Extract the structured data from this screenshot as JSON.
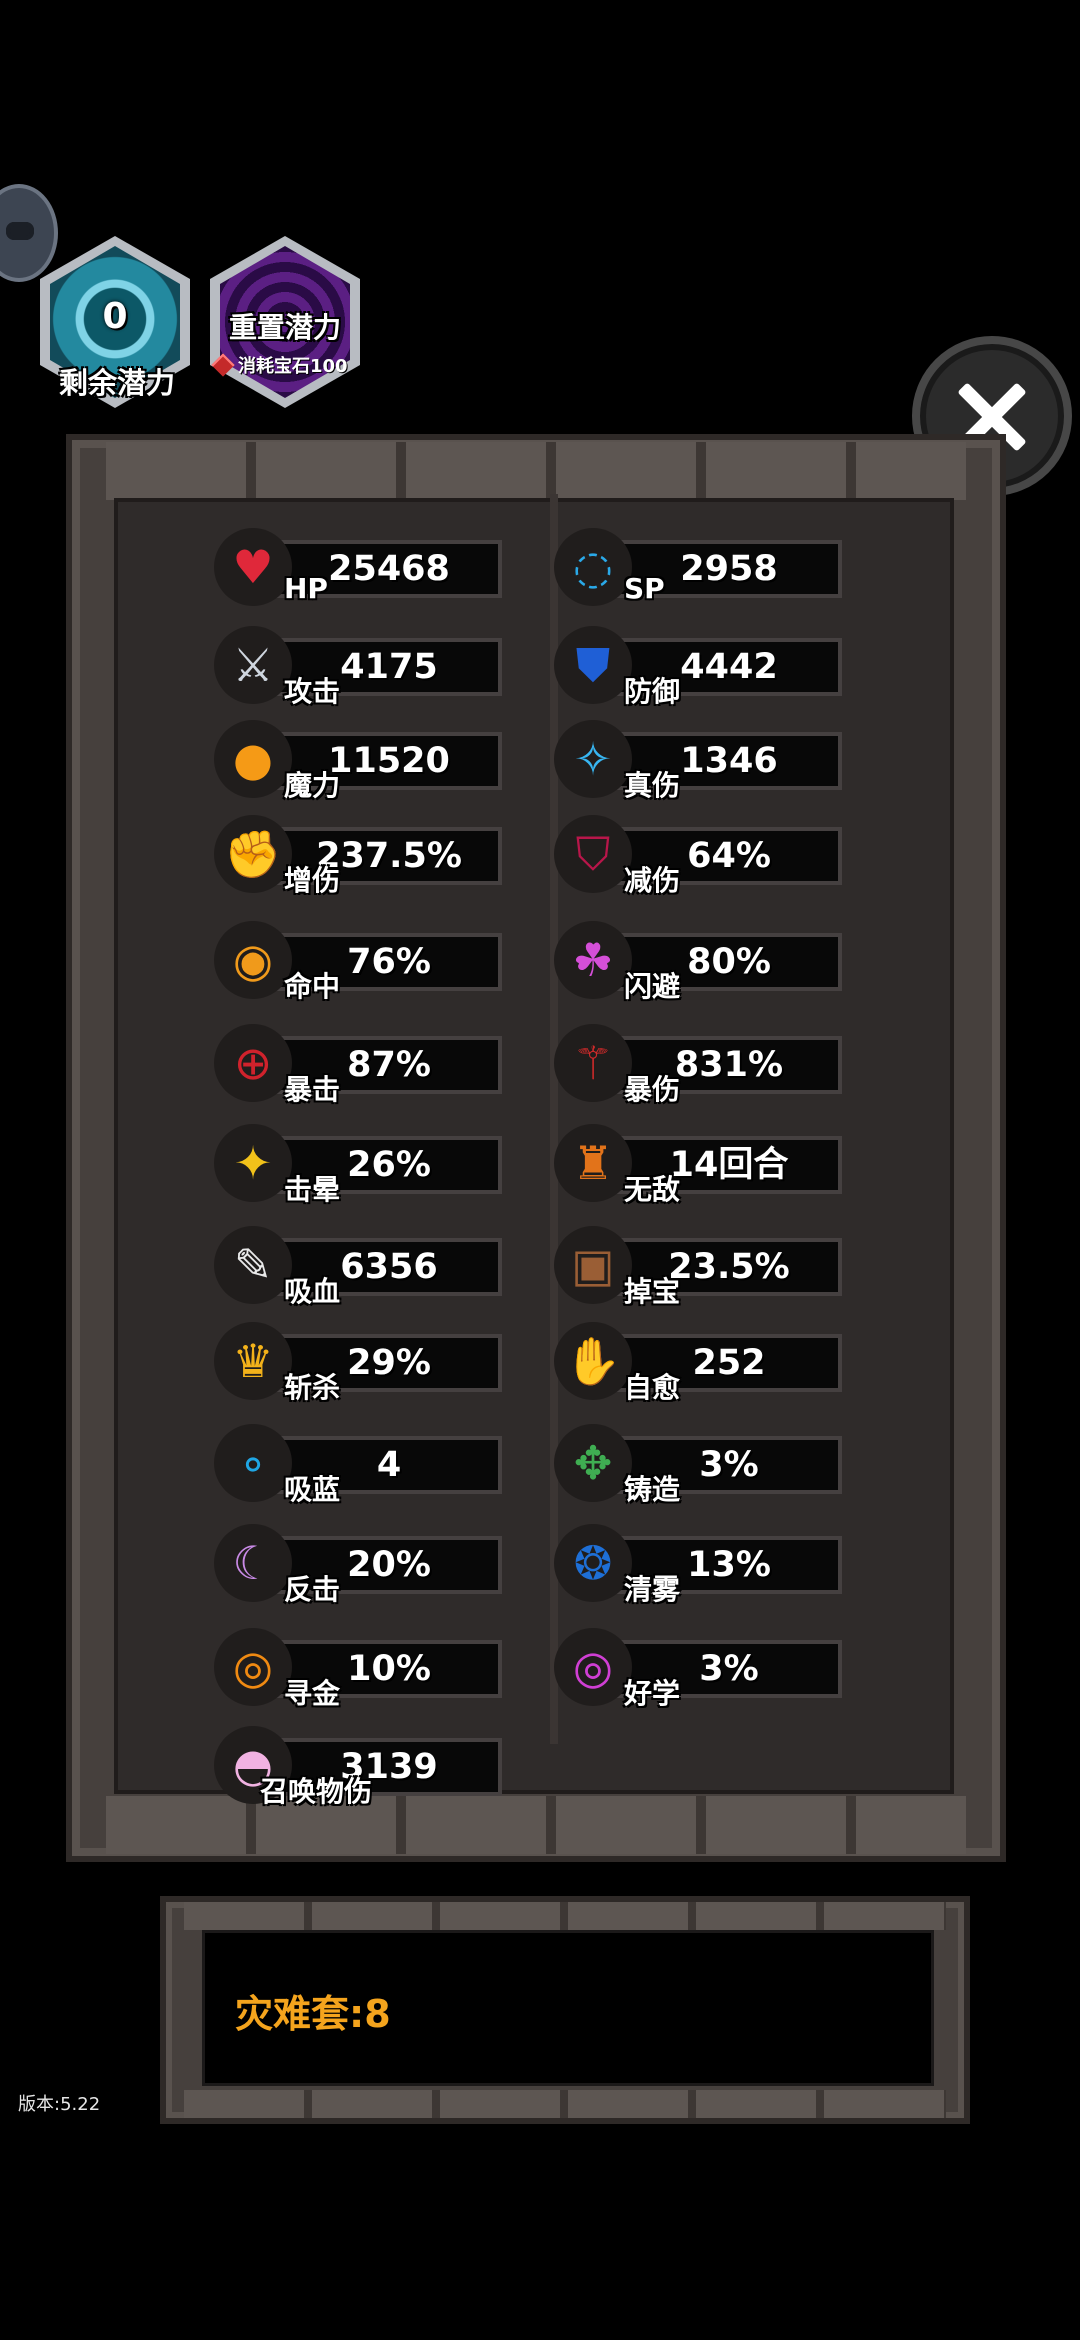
{
  "potential": {
    "remaining_value": "0",
    "remaining_label": "剩余潜力"
  },
  "reset": {
    "title": "重置潜力",
    "cost": "消耗宝石100"
  },
  "stats_left": [
    {
      "id": "hp",
      "label": "HP",
      "value": "25468",
      "icon": "heart-icon"
    },
    {
      "id": "attack",
      "label": "攻击",
      "value": "4175",
      "icon": "crossed-swords-icon"
    },
    {
      "id": "magic",
      "label": "魔力",
      "value": "11520",
      "icon": "magic-orb-icon"
    },
    {
      "id": "damage-boost",
      "label": "增伤",
      "value": "237.5%",
      "icon": "fist-icon"
    },
    {
      "id": "accuracy",
      "label": "命中",
      "value": "76%",
      "icon": "eye-icon"
    },
    {
      "id": "crit",
      "label": "暴击",
      "value": "87%",
      "icon": "crosshair-icon"
    },
    {
      "id": "stun",
      "label": "击晕",
      "value": "26%",
      "icon": "stars-icon"
    },
    {
      "id": "lifesteal",
      "label": "吸血",
      "value": "6356",
      "icon": "syringe-icon"
    },
    {
      "id": "execute",
      "label": "斩杀",
      "value": "29%",
      "icon": "crown-icon"
    },
    {
      "id": "mana-drain",
      "label": "吸蓝",
      "value": "4",
      "icon": "bubbles-icon"
    },
    {
      "id": "counter",
      "label": "反击",
      "value": "20%",
      "icon": "crescent-icon"
    },
    {
      "id": "gold-find",
      "label": "寻金",
      "value": "10%",
      "icon": "gold-coin-icon"
    },
    {
      "id": "summon",
      "label": "召唤物伤",
      "value": "3139",
      "icon": "summon-icon"
    }
  ],
  "stats_right": [
    {
      "id": "sp",
      "label": "SP",
      "value": "2958",
      "icon": "vortex-icon"
    },
    {
      "id": "defense",
      "label": "防御",
      "value": "4442",
      "icon": "blue-shield-icon"
    },
    {
      "id": "true-damage",
      "label": "真伤",
      "value": "1346",
      "icon": "blue-flame-icon"
    },
    {
      "id": "damage-reduction",
      "label": "减伤",
      "value": "64%",
      "icon": "red-shield-icon"
    },
    {
      "id": "dodge",
      "label": "闪避",
      "value": "80%",
      "icon": "running-figure-icon"
    },
    {
      "id": "crit-damage",
      "label": "暴伤",
      "value": "831%",
      "icon": "red-sword-icon"
    },
    {
      "id": "invincible",
      "label": "无敌",
      "value": "14回合",
      "icon": "totem-icon"
    },
    {
      "id": "loot",
      "label": "掉宝",
      "value": "23.5%",
      "icon": "chest-icon"
    },
    {
      "id": "heal",
      "label": "自愈",
      "value": "252",
      "icon": "healing-hand-icon"
    },
    {
      "id": "forge",
      "label": "铸造",
      "value": "3%",
      "icon": "forge-gem-icon"
    },
    {
      "id": "fog-clear",
      "label": "清雾",
      "value": "13%",
      "icon": "blue-rune-icon"
    },
    {
      "id": "studious",
      "label": "好学",
      "value": "3%",
      "icon": "pink-rune-icon"
    }
  ],
  "set_bonus": "灾难套:8",
  "version": "版本:5.22"
}
